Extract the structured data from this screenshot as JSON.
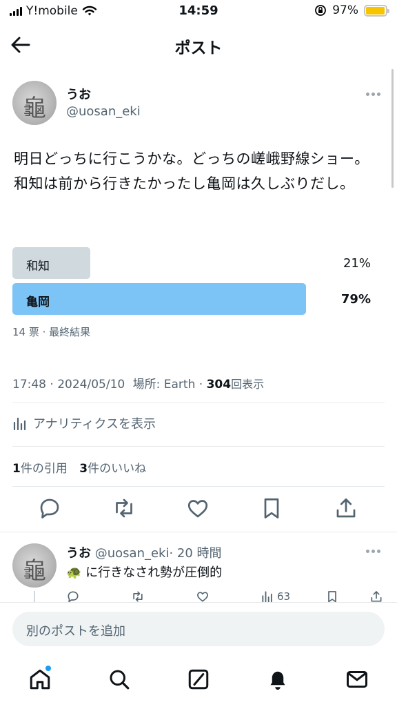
{
  "status_bar": {
    "carrier": "Y!mobile",
    "time": "14:59",
    "battery": "97%",
    "battery_level": 0.97
  },
  "header": {
    "title": "ポスト"
  },
  "post": {
    "author_name": "うお",
    "author_handle": "@uosan_eki",
    "text": "明日どっちに行こうかな。どっちの嵯峨野線ショー。和知は前から行きたかったし亀岡は久しぶりだし。",
    "poll": {
      "options": [
        {
          "label": "和知",
          "percent": "21%",
          "value": 0.21
        },
        {
          "label": "亀岡",
          "percent": "79%",
          "value": 0.79
        }
      ],
      "summary": "14 票 · 最終結果"
    },
    "time": "17:48",
    "date": "2024/05/10",
    "location_label": "場所:",
    "location": "Earth",
    "views_count": "304",
    "views_label": "回表示",
    "analytics_label": "アナリティクスを表示",
    "quotes_count": "1",
    "quotes_label": "件の引用",
    "likes_count": "3",
    "likes_label": "件のいいね"
  },
  "reply": {
    "author_name": "うお",
    "author_handle": "@uosan_eki",
    "time_ago": "· 20 時間",
    "text": "に行きなされ勢が圧倒的",
    "emoji": "🐢",
    "views": "63"
  },
  "composer": {
    "placeholder": "別のポストを追加"
  },
  "colors": {
    "accent": "#1d9bf0",
    "poll_winner": "#7dc4f6",
    "poll_other": "#cfd9de",
    "secondary_text": "#536471"
  },
  "icons": {
    "back": "arrow-left-icon",
    "more": "more-dots-icon",
    "analytics": "bar-chart-icon",
    "reply": "reply-icon",
    "repost": "repost-icon",
    "like": "heart-icon",
    "bookmark": "bookmark-icon",
    "share": "share-icon",
    "nav": [
      "home-icon",
      "search-icon",
      "grok-icon",
      "notifications-icon",
      "messages-icon"
    ]
  }
}
